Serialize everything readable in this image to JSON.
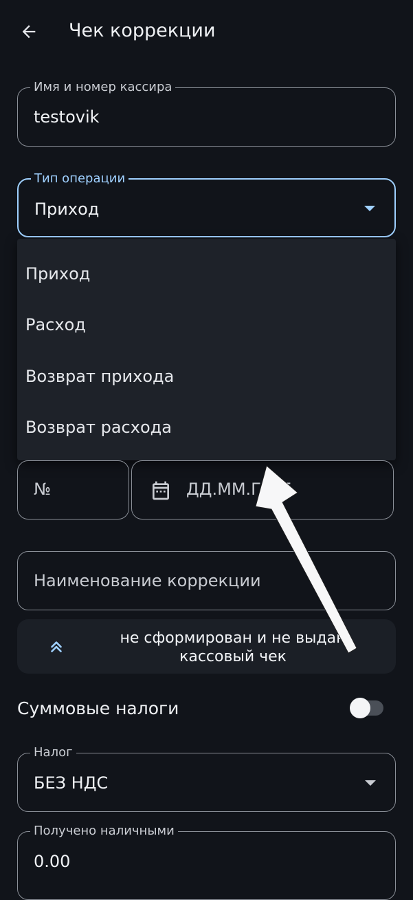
{
  "header": {
    "title": "Чек коррекции",
    "back_icon": "arrow-back-icon"
  },
  "cashier": {
    "label": "Имя и номер кассира",
    "value": "testovik"
  },
  "operation_type": {
    "label": "Тип операции",
    "value": "Приход",
    "options": [
      "Приход",
      "Расход",
      "Возврат прихода",
      "Возврат расхода"
    ]
  },
  "document": {
    "number_placeholder": "№",
    "date_placeholder": "ДД.ММ.ГГГГ",
    "calendar_icon": "calendar-icon"
  },
  "correction_name": {
    "placeholder": "Наименование коррекции"
  },
  "reason_banner": {
    "text": "не сформирован и не выдан кассовый чек",
    "icon": "double-chevron-up-icon"
  },
  "sum_taxes": {
    "label": "Суммовые налоги",
    "enabled": false
  },
  "tax": {
    "label": "Налог",
    "value": "БЕЗ НДС"
  },
  "cash_received": {
    "label": "Получено наличными",
    "value": "0.00"
  },
  "colors": {
    "background": "#11141a",
    "accent": "#9fd0ff",
    "menu_background": "#1e2229"
  }
}
